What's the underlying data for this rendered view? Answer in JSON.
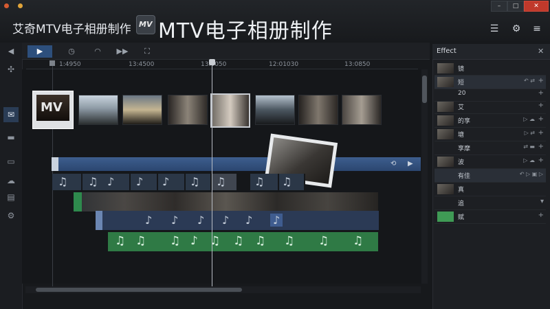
{
  "app": {
    "title": "艾奇MTV电子相册制作",
    "logo_text": "MV",
    "big_title": "MTV电子相册制作"
  },
  "window_controls": {
    "minimize": "–",
    "maximize": "□",
    "close": "✕"
  },
  "top_icons": [
    "list-icon",
    "gear-icon",
    "menu-icon"
  ],
  "top_icon_glyphs": [
    "☰",
    "⚙",
    "≡"
  ],
  "sidebar_glyphs": [
    "✣",
    "✉",
    "▬",
    "▭",
    "☁",
    "▤",
    "⚙"
  ],
  "toolbar_glyphs": [
    "◀",
    "▶",
    "◷",
    "◠",
    "▶▶",
    "⛶"
  ],
  "timeline": {
    "ruler_labels": [
      "1:4950",
      "13:4500",
      "13:0050",
      "12:01030",
      "13:0850"
    ],
    "mv_thumb_label": "MV",
    "music_note": "♫",
    "single_note": "♪",
    "video_track_controls": [
      "⟲",
      "▶"
    ]
  },
  "effect_panel": {
    "title": "Effect",
    "close": "✕",
    "rows": [
      {
        "label": "镜",
        "controls": "",
        "plus": ""
      },
      {
        "label": "短",
        "controls": "↶ ⇄",
        "plus": "+"
      },
      {
        "label": "20",
        "controls": "",
        "plus": "+"
      },
      {
        "label": "艾",
        "controls": "",
        "plus": "+"
      },
      {
        "label": "的享",
        "controls": "▷ ☁",
        "plus": "+"
      },
      {
        "label": "塘",
        "controls": "▷ ⇄",
        "plus": "+"
      },
      {
        "label": "享摩",
        "controls": "⇄ ▬",
        "plus": "+"
      },
      {
        "label": "波",
        "controls": "▷ ☁",
        "plus": "+"
      },
      {
        "label": "有佳",
        "controls": "↶ ▷ ▣ ▷",
        "plus": ""
      },
      {
        "label": "真",
        "controls": "",
        "plus": ""
      },
      {
        "label": "追",
        "controls": "",
        "plus": "▾"
      },
      {
        "label": "赋",
        "controls": "",
        "plus": "+"
      }
    ]
  }
}
